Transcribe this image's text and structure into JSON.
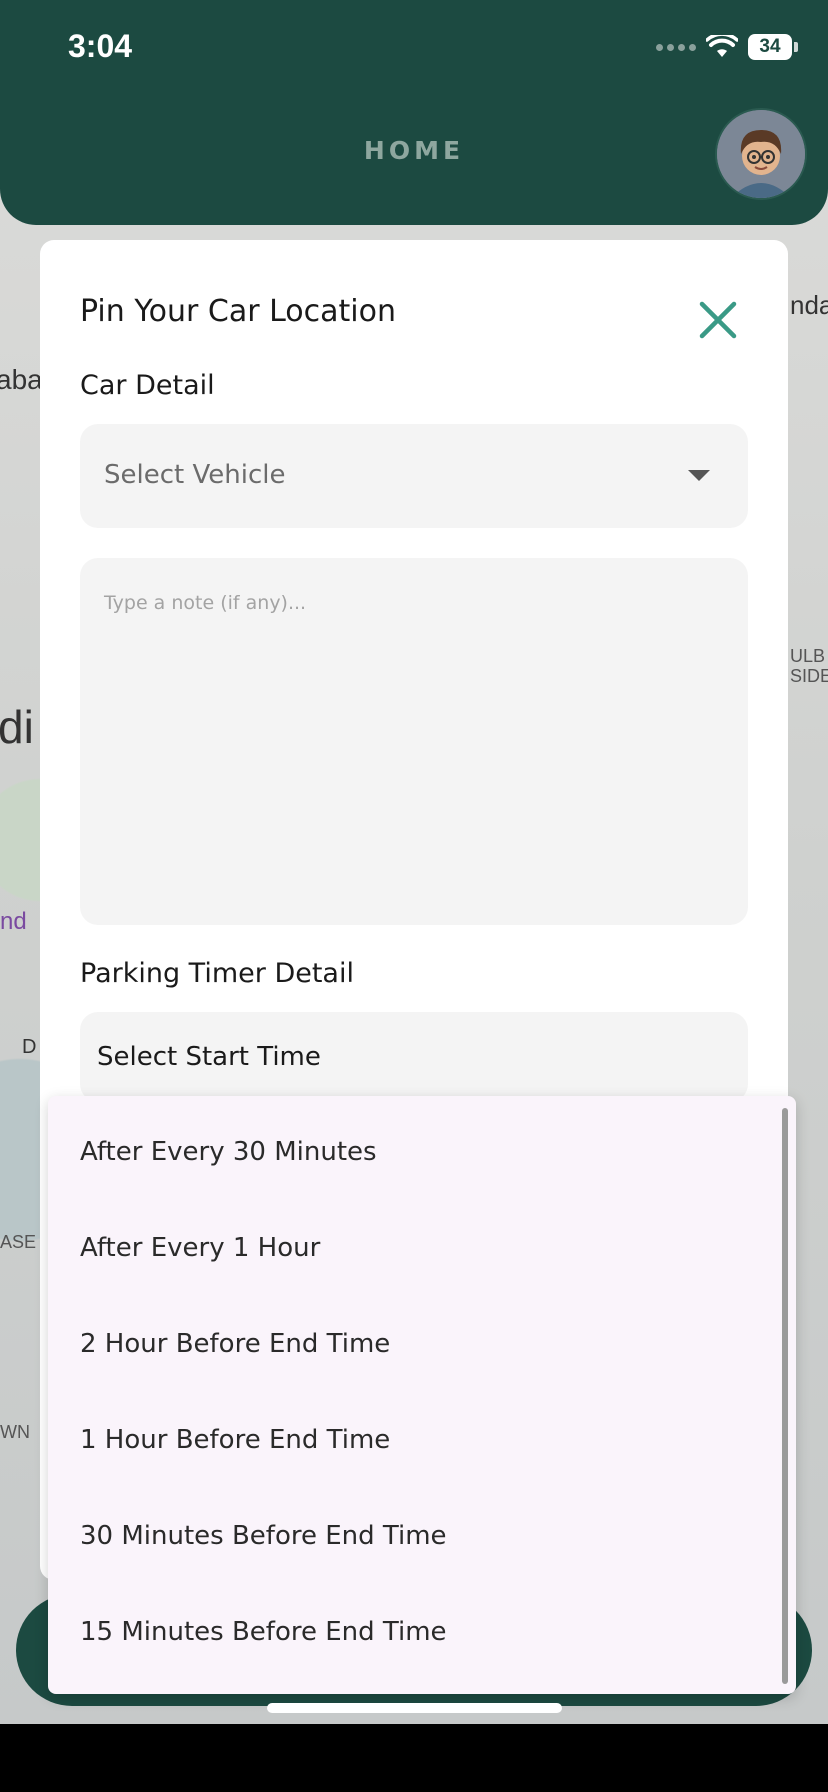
{
  "status_bar": {
    "time": "3:04",
    "battery": "34"
  },
  "header": {
    "title": "HOME"
  },
  "map": {
    "labels": [
      "aba",
      "di",
      "nd",
      "D",
      "ASE",
      "WN",
      "nda",
      "ULB",
      "SIDE"
    ]
  },
  "modal": {
    "title": "Pin Your Car Location",
    "car_detail_label": "Car Detail",
    "vehicle_select_value": "Select Vehicle",
    "note_placeholder": "Type a note (if any)...",
    "parking_timer_label": "Parking Timer Detail",
    "start_time_value": "Select Start Time"
  },
  "dropdown": {
    "options": [
      "After Every 30 Minutes",
      "After Every 1 Hour",
      "2 Hour Before End Time",
      "1 Hour Before End Time",
      "30 Minutes Before End Time",
      "15 Minutes Before End Time"
    ]
  },
  "colors": {
    "header": "#1c4a41",
    "accent": "#3a9a86",
    "dropdown_bg": "#faf4fb"
  }
}
